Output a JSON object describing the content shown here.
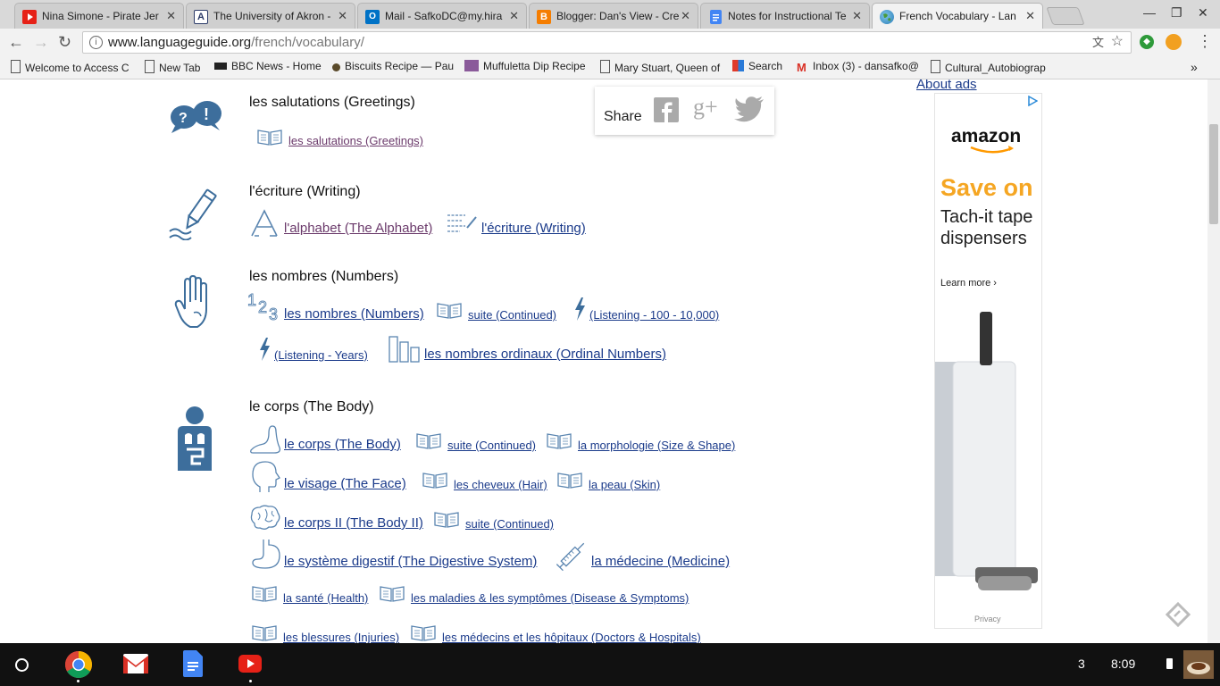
{
  "tabs": [
    {
      "title": "Nina Simone - Pirate Jer",
      "favicon": "youtube-icon",
      "color": "#e62117"
    },
    {
      "title": "The University of Akron -",
      "favicon": "akron-icon",
      "color": "#2b3a67"
    },
    {
      "title": "Mail - SafkoDC@my.hira",
      "favicon": "outlook-icon",
      "color": "#0072c6"
    },
    {
      "title": "Blogger: Dan's View - Cre",
      "favicon": "blogger-icon",
      "color": "#f57d00"
    },
    {
      "title": "Notes for Instructional Te",
      "favicon": "docs-icon",
      "color": "#4285f4"
    },
    {
      "title": "French Vocabulary - Lan",
      "favicon": "globe-icon",
      "color": "#3a8a3a",
      "active": true
    }
  ],
  "toolbar": {
    "url_host": "www.languageguide.org",
    "url_path": "/french/vocabulary/"
  },
  "bookmarks": [
    {
      "label": "Welcome to Access C",
      "icon": "page-icon"
    },
    {
      "label": "New Tab",
      "icon": "page-icon"
    },
    {
      "label": "BBC News - Home",
      "icon": "bbc-icon"
    },
    {
      "label": "Biscuits Recipe — Pau",
      "icon": "pin-icon"
    },
    {
      "label": "Muffuletta Dip Recipe",
      "icon": "mr-icon"
    },
    {
      "label": "Mary Stuart, Queen of",
      "icon": "page-icon"
    },
    {
      "label": "Search",
      "icon": "search-app-icon"
    },
    {
      "label": "Inbox (3) - dansafko@",
      "icon": "gmail-icon"
    },
    {
      "label": "Cultural_Autobiograp",
      "icon": "page-icon"
    }
  ],
  "share": {
    "label": "Share"
  },
  "ads": {
    "about": "About ads",
    "brand": "amazon",
    "headline": "Save on",
    "product": "Tach-it tape dispensers",
    "cta": "Learn more ›",
    "privacy": "Privacy"
  },
  "sections": {
    "greetings": {
      "heading": "les salutations (Greetings)",
      "links": [
        "les salutations (Greetings)"
      ]
    },
    "writing": {
      "heading": "l'écriture (Writing)",
      "links": [
        "l'alphabet (The Alphabet)",
        "l'écriture (Writing)"
      ]
    },
    "numbers": {
      "heading": "les nombres (Numbers)",
      "links": [
        "les nombres (Numbers)",
        "suite (Continued)",
        " (Listening - 100 - 10,000)",
        " (Listening - Years)",
        "les nombres ordinaux (Ordinal Numbers)"
      ]
    },
    "body": {
      "heading": "le corps (The Body)",
      "links": [
        "le corps (The Body)",
        "suite (Continued)",
        "la morphologie (Size & Shape)",
        "le visage (The Face)",
        "les cheveux (Hair)",
        "la peau (Skin)",
        "le corps II (The Body II)",
        "suite (Continued)",
        "le système digestif (The Digestive System)",
        "la médecine (Medicine)",
        "la santé (Health)",
        "les maladies & les symptômes (Disease & Symptoms)",
        "les blessures (Injuries)",
        "les médecins et les hôpitaux (Doctors & Hospitals)"
      ]
    }
  },
  "shelf": {
    "notification_count": "3",
    "time": "8:09"
  },
  "colors": {
    "icon_blue": "#3d6e9c",
    "link_blue": "#1a3a8a",
    "visited": "#6b3a6b"
  }
}
